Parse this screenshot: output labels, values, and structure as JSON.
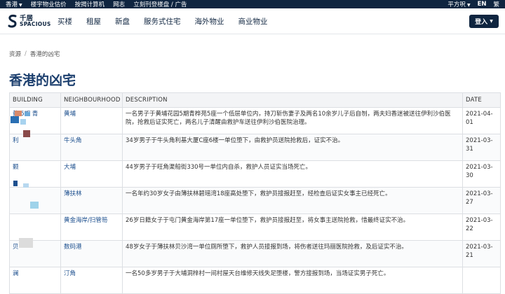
{
  "topbar": {
    "region": "香港",
    "links": [
      "楼宇物业估价",
      "按揭计算机",
      "网志",
      "立刻刊登楼盘 / 广告"
    ],
    "unit": "平方呎",
    "lang_tc": "繁",
    "lang_en": "EN"
  },
  "logo": {
    "cn": "千居",
    "en": "SPACIOUS"
  },
  "nav": {
    "items": [
      "买楼",
      "租屋",
      "新盘",
      "服务式住宅",
      "海外物业",
      "商业物业"
    ],
    "login": "登入"
  },
  "breadcrumb": {
    "home": "资源",
    "sep": "/",
    "current": "香港的凶宅"
  },
  "page_title": "香港的凶宅",
  "table": {
    "headers": [
      "BUILDING",
      "NEIGHBOURHOOD",
      "DESCRIPTION",
      "DATE"
    ],
    "rows": [
      {
        "building": "黄   5期 青",
        "neighbourhood": "黄埔",
        "description": "一名男子于黄埔花园5期青桦苑5座一个低层单位内，持刀斩伤妻子及两名10余岁儿子后自刎，两夫妇香迷被送往伊利沙伯医院，抢救后证实死亡，两名儿子清醒由救护车送往伊利沙伯医院治理。",
        "date": "2021-04-01"
      },
      {
        "building": "利",
        "neighbourhood": "牛头角",
        "description": "34岁男子于牛头角利基大厦C座6楼一单位堕下，由救护员送院抢救后，证实不治。",
        "date": "2021-03-31"
      },
      {
        "building": "颢",
        "neighbourhood": "大埔",
        "description": "44岁男子于旺角渠船街330号一单位内自杀，救护人员证实当场死亡。",
        "date": "2021-03-30"
      },
      {
        "building": "",
        "neighbourhood": "薄扶林",
        "description": "一名年约30岁女子由薄扶林碧瑶湾18座高处堕下，救护员接报赶至，经检查后证实女事主已经死亡。",
        "date": "2021-03-27"
      },
      {
        "building": "",
        "neighbourhood": "黄金海岸/扫管笏",
        "description": "26岁日籍女子于屯门黄金海岸第17座一单位堕下，救护员接报赶至，将女事主送院抢救，惜最终证实不治。",
        "date": "2021-03-22"
      },
      {
        "building": "贝",
        "neighbourhood": "数码港",
        "description": "48岁女子于薄扶林贝沙湾一单位厕所堕下，救护人员接报到场，将伤者送往玛丽医院抢救，及后证实不治。",
        "date": "2021-03-21"
      },
      {
        "building": "澜",
        "neighbourhood": "汀角",
        "description": "一名50多岁男子于大埔洞梓村一间村屋天台维修天线失足堕楼，警方接报到场，当场证实男子死亡。",
        "date": ""
      }
    ]
  },
  "colors": {
    "navy": "#0f2540",
    "title": "#1c3f6e",
    "link": "#1c4f8e"
  }
}
